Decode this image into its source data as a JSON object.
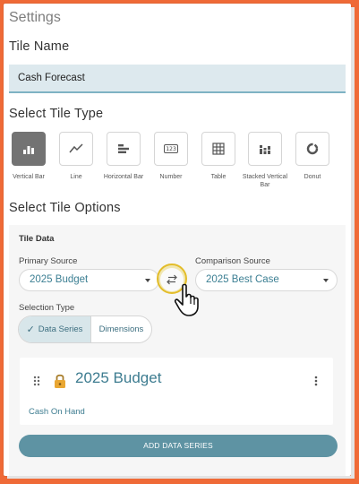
{
  "settings_title": "Settings",
  "tile_name": {
    "heading": "Tile Name",
    "value": "Cash Forecast"
  },
  "tile_type": {
    "heading": "Select Tile Type",
    "types": [
      {
        "label": "Vertical Bar",
        "icon": "vertical-bar-chart-icon",
        "selected": true
      },
      {
        "label": "Line",
        "icon": "line-chart-icon",
        "selected": false
      },
      {
        "label": "Horizontal Bar",
        "icon": "horizontal-bar-chart-icon",
        "selected": false
      },
      {
        "label": "Number",
        "icon": "number-icon",
        "selected": false,
        "glyph": "123"
      },
      {
        "label": "Table",
        "icon": "table-icon",
        "selected": false
      },
      {
        "label": "Stacked Vertical Bar",
        "icon": "stacked-bar-chart-icon",
        "selected": false
      },
      {
        "label": "Donut",
        "icon": "donut-chart-icon",
        "selected": false
      }
    ]
  },
  "tile_options": {
    "heading": "Select Tile Options",
    "tile_data_label": "Tile Data",
    "primary_source": {
      "label": "Primary Source",
      "value": "2025 Budget"
    },
    "comparison_source": {
      "label": "Comparison Source",
      "value": "2025 Best Case"
    },
    "selection_type": {
      "label": "Selection Type",
      "options": [
        "Data Series",
        "Dimensions"
      ],
      "selected": "Data Series"
    },
    "series_card": {
      "title": "2025 Budget",
      "subtitle": "Cash On Hand"
    },
    "add_button": "ADD DATA SERIES"
  },
  "colors": {
    "accent": "#3d7c90",
    "background": "#ef6a37",
    "button": "#5e93a3"
  }
}
